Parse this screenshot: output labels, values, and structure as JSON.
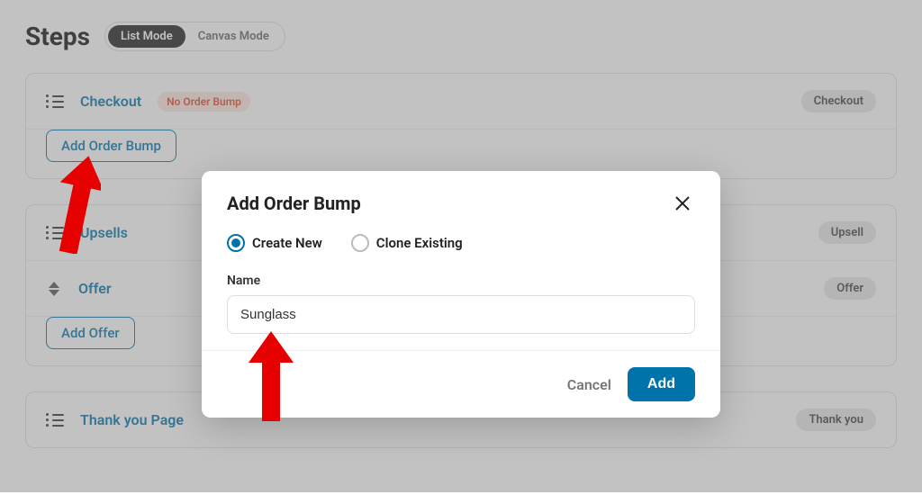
{
  "header": {
    "title": "Steps",
    "modes": {
      "list": "List Mode",
      "canvas": "Canvas Mode"
    }
  },
  "steps": {
    "checkout": {
      "label": "Checkout",
      "warn": "No Order Bump",
      "type": "Checkout",
      "action": "Add Order Bump"
    },
    "upsells": {
      "label": "Upsells",
      "type": "Upsell",
      "offer_label": "Offer",
      "offer_type": "Offer",
      "action": "Add Offer"
    },
    "thankyou": {
      "label": "Thank you Page",
      "type": "Thank you"
    }
  },
  "modal": {
    "title": "Add Order Bump",
    "options": {
      "create": "Create New",
      "clone": "Clone Existing"
    },
    "field_label": "Name",
    "name_value": "Sunglass",
    "cancel": "Cancel",
    "add": "Add"
  }
}
